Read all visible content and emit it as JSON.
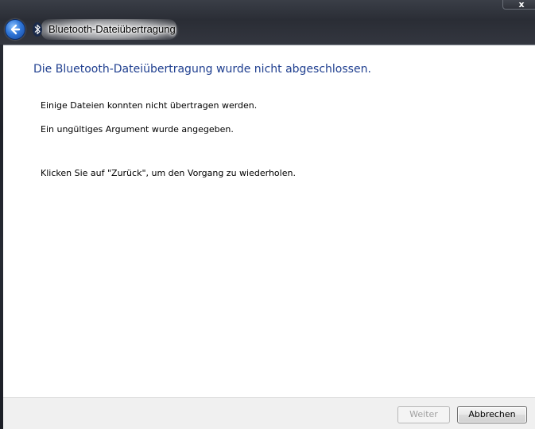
{
  "window": {
    "title": "Bluetooth-Dateiübertragung",
    "close_label": "x"
  },
  "icons": {
    "back": "back-arrow-icon",
    "app": "bluetooth-icon"
  },
  "main": {
    "heading": "Die Bluetooth-Dateiübertragung wurde nicht abgeschlossen.",
    "messages": [
      "Einige Dateien konnten nicht übertragen werden.",
      "Ein ungültiges Argument wurde angegeben.",
      "Klicken Sie auf \"Zurück\", um den Vorgang zu wiederholen."
    ]
  },
  "footer": {
    "next_label": "Weiter",
    "next_enabled": false,
    "cancel_label": "Abbrechen"
  },
  "colors": {
    "heading": "#1e3e8f",
    "accent": "#2f76d8"
  }
}
